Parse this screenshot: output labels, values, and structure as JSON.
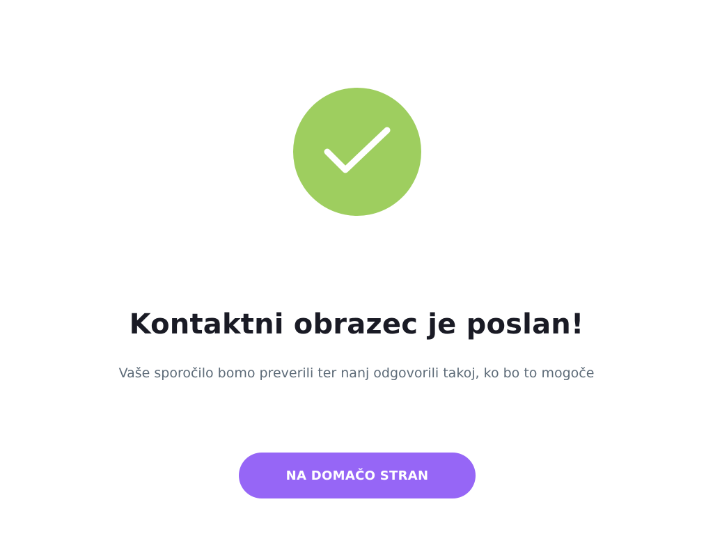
{
  "success": {
    "icon": "checkmark-icon",
    "circle_color": "#9ece5f",
    "check_color": "#ffffff"
  },
  "message": {
    "title": "Kontaktni obrazec je poslan!",
    "subtitle": "Vaše sporočilo bomo preverili ter nanj odgovorili takoj, ko bo to mogoče"
  },
  "actions": {
    "home_label": "NA DOMAČO STRAN",
    "home_color": "#9666f6"
  }
}
